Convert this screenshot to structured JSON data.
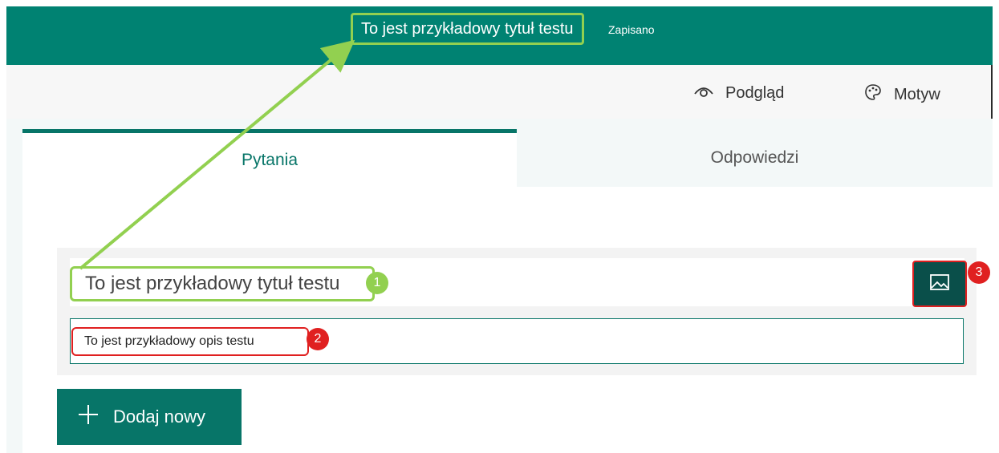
{
  "header": {
    "form_title": "To jest przykładowy tytuł testu",
    "save_status": "Zapisano"
  },
  "toolbar": {
    "preview_label": "Podgląd",
    "theme_label": "Motyw"
  },
  "tabs": [
    {
      "label": "Pytania",
      "active": true
    },
    {
      "label": "Odpowiedzi",
      "active": false
    }
  ],
  "form": {
    "title_value": "To jest przykładowy tytuł testu",
    "description_value": "To jest przykładowy opis testu",
    "add_new_label": "Dodaj nowy"
  },
  "annotations": {
    "badge_1": "1",
    "badge_2": "2",
    "badge_3": "3"
  },
  "colors": {
    "brand": "#008272",
    "accent_green": "#92d050",
    "accent_red": "#e02020"
  }
}
